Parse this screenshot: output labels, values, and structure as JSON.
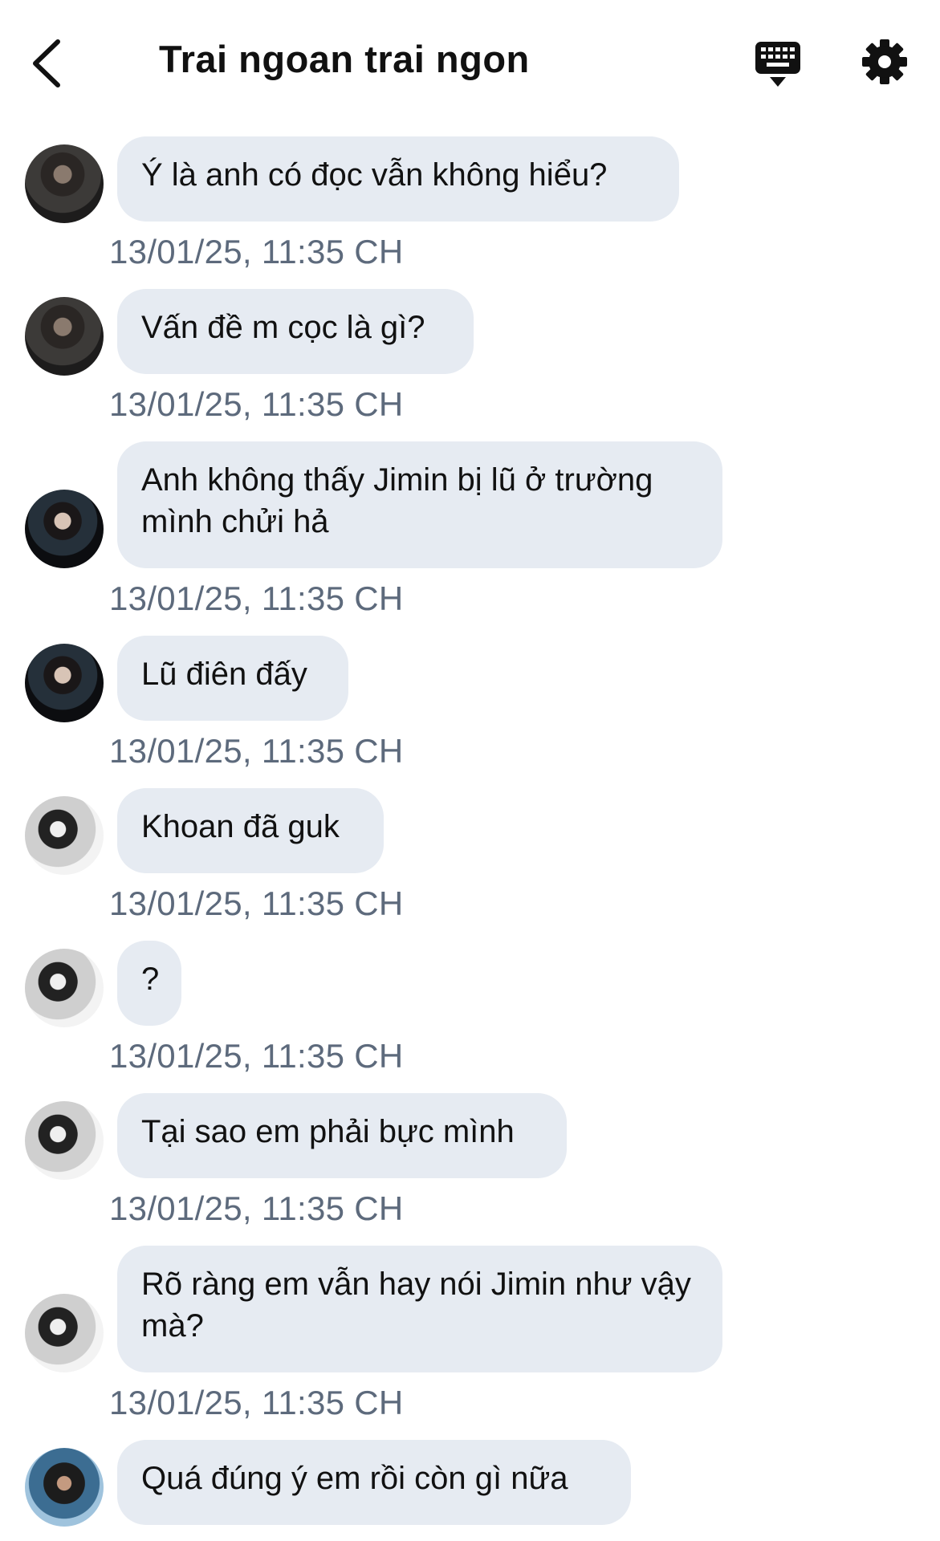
{
  "header": {
    "title": "Trai ngoan trai ngon",
    "back_icon": "chevron-left-icon",
    "keyboard_icon": "keyboard-icon",
    "settings_icon": "gear-icon"
  },
  "colors": {
    "bubble": "#e6ebf2",
    "timestamp": "#5d6a7c",
    "text": "#111111"
  },
  "messages": [
    {
      "avatar": "avatar-a",
      "text": "Ý là anh có đọc vẫn không hiểu?",
      "time": "13/01/25, 11:35 CH"
    },
    {
      "avatar": "avatar-a",
      "text": "Vấn đề m cọc là gì?",
      "time": "13/01/25, 11:35 CH"
    },
    {
      "avatar": "avatar-b",
      "text": "Anh không thấy Jimin bị lũ ở trường mình chửi hả",
      "time": "13/01/25, 11:35 CH"
    },
    {
      "avatar": "avatar-b",
      "text": "Lũ điên đấy",
      "time": "13/01/25, 11:35 CH"
    },
    {
      "avatar": "avatar-c",
      "text": "Khoan đã guk",
      "time": "13/01/25, 11:35 CH"
    },
    {
      "avatar": "avatar-c",
      "text": "?",
      "time": "13/01/25, 11:35 CH"
    },
    {
      "avatar": "avatar-c",
      "text": "Tại sao em phải bực mình",
      "time": "13/01/25, 11:35 CH"
    },
    {
      "avatar": "avatar-c",
      "text": "Rõ ràng em vẫn hay nói Jimin như vậy mà?",
      "time": "13/01/25, 11:35 CH"
    },
    {
      "avatar": "avatar-d",
      "text": "Quá đúng ý em rồi còn gì nữa",
      "time": ""
    }
  ]
}
